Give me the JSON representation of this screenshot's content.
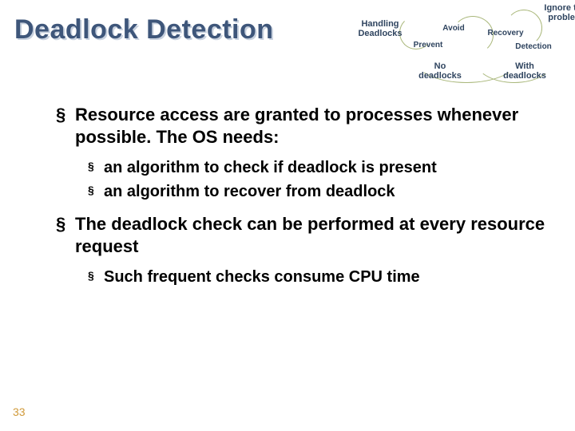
{
  "title": "Deadlock Detection",
  "diagram": {
    "root": "Handling\nDeadlocks",
    "avoid": "Avoid",
    "prevent": "Prevent",
    "nodl": "No\ndeadlocks",
    "withdl": "With\ndeadlocks",
    "recovery": "Recovery",
    "detection": "Detection",
    "ignore": "Ignore the\nproblem"
  },
  "bullets": {
    "b1a": "Resource access are granted to processes whenever possible. The OS needs:",
    "b2a": "an algorithm to check if deadlock is present",
    "b2b": "an algorithm to recover from deadlock",
    "b1b": "The deadlock check can be performed at every resource request",
    "b2c": "Such frequent checks consume CPU time"
  },
  "page": "33"
}
